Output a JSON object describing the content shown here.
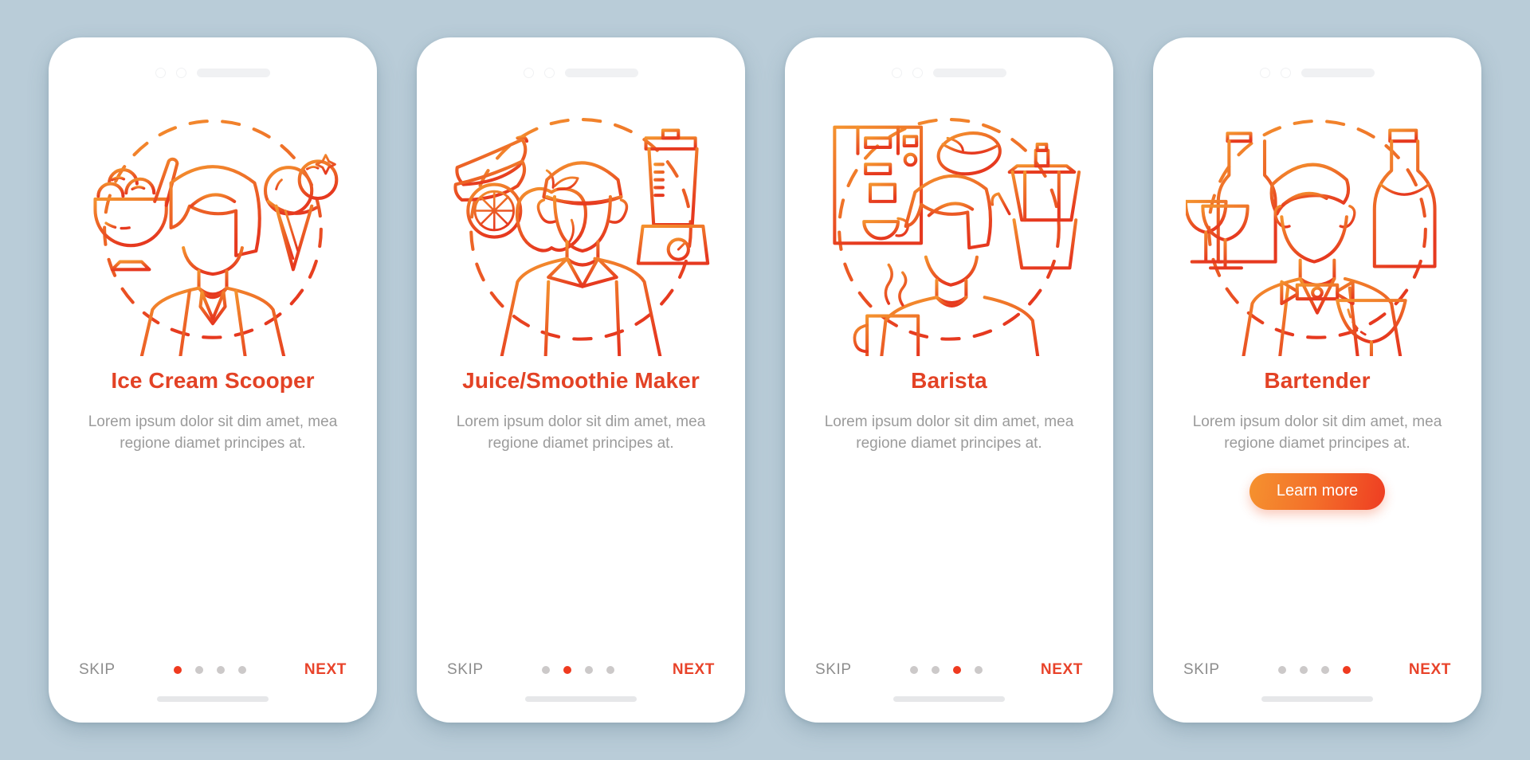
{
  "background_color": "#b9ccd8",
  "accent_color": "#e8432a",
  "muted_text_color": "#9b9b9b",
  "cta_gradient": [
    "#f5922f",
    "#ee3d22"
  ],
  "common": {
    "skip_label": "SKIP",
    "next_label": "NEXT",
    "description": "Lorem ipsum dolor sit dim amet, mea regione diamet principes at.",
    "total_dots": 4
  },
  "screens": [
    {
      "id": "ice-cream-scooper",
      "title": "Ice Cream Scooper",
      "description": "Lorem ipsum dolor sit dim amet, mea regione diamet principes at.",
      "skip_label": "SKIP",
      "next_label": "NEXT",
      "active_dot": 1,
      "cta_label": "",
      "has_cta": false,
      "illustration": "ice-cream-scooper-illustration"
    },
    {
      "id": "juice-smoothie-maker",
      "title": "Juice/Smoothie Maker",
      "description": "Lorem ipsum dolor sit dim amet, mea regione diamet principes at.",
      "skip_label": "SKIP",
      "next_label": "NEXT",
      "active_dot": 2,
      "cta_label": "",
      "has_cta": false,
      "illustration": "juice-smoothie-maker-illustration"
    },
    {
      "id": "barista",
      "title": "Barista",
      "description": "Lorem ipsum dolor sit dim amet, mea regione diamet principes at.",
      "skip_label": "SKIP",
      "next_label": "NEXT",
      "active_dot": 3,
      "cta_label": "",
      "has_cta": false,
      "illustration": "barista-illustration"
    },
    {
      "id": "bartender",
      "title": "Bartender",
      "description": "Lorem ipsum dolor sit dim amet, mea regione diamet principes at.",
      "skip_label": "SKIP",
      "next_label": "NEXT",
      "active_dot": 4,
      "cta_label": "Learn more",
      "has_cta": true,
      "illustration": "bartender-illustration"
    }
  ]
}
